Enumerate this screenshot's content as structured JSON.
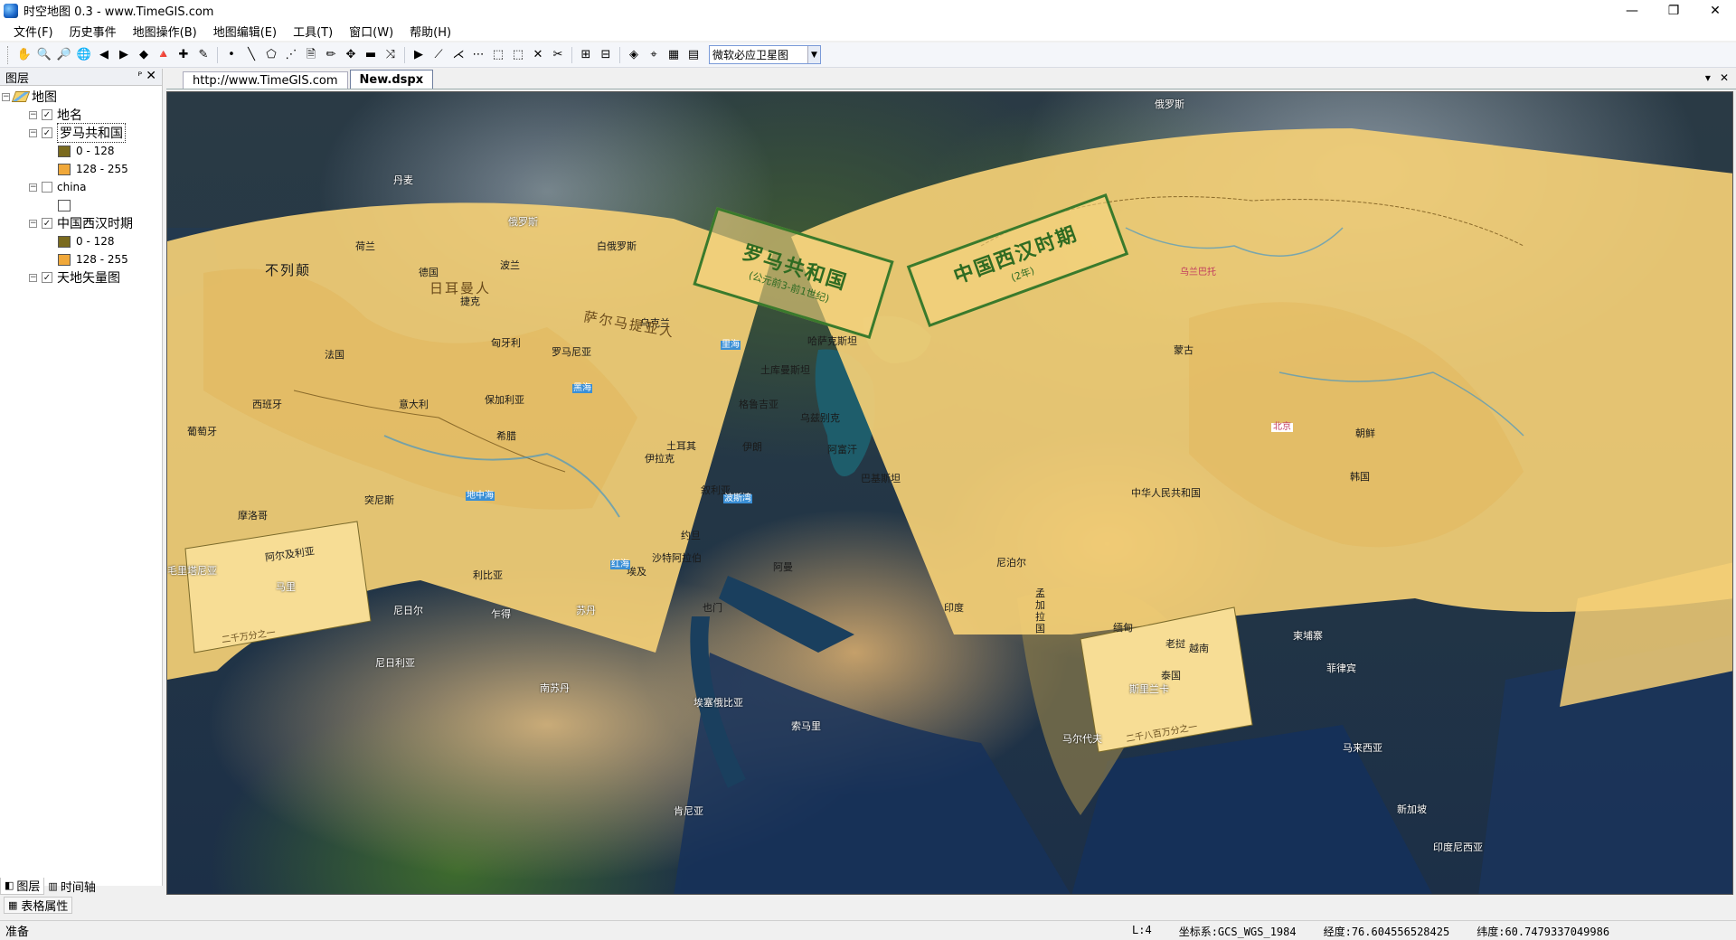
{
  "window": {
    "title": "时空地图 0.3 - www.TimeGIS.com",
    "minimize": "—",
    "restore": "❐",
    "close": "✕"
  },
  "menu": [
    "文件(F)",
    "历史事件",
    "地图操作(B)",
    "地图编辑(E)",
    "工具(T)",
    "窗口(W)",
    "帮助(H)"
  ],
  "toolbar": {
    "basemap_select": "微软必应卫星图",
    "icons": [
      "pan-icon",
      "zoom-in-icon",
      "zoom-out-icon",
      "globe-icon",
      "back-icon",
      "forward-icon",
      "layer-add-icon",
      "identify-icon",
      "add-feature-icon",
      "edit-feature-icon",
      "point-icon",
      "line-icon",
      "polygon-icon",
      "node-icon",
      "save-edit-icon",
      "measure-icon",
      "move-icon",
      "delete-feature-icon",
      "split-icon",
      "play-icon",
      "select-line-icon",
      "snap-icon",
      "vertex-icon",
      "select-icon",
      "select-clear-icon",
      "delete-icon",
      "cut-icon",
      "grid-icon",
      "table-icon",
      "compass-icon",
      "binoculars-icon",
      "chart-icon",
      "attribute-table-icon"
    ],
    "glyphs": [
      "✋",
      "🔍",
      "🔎",
      "🌐",
      "◀",
      "▶",
      "◆",
      "🔺",
      "✚",
      "✎",
      "•",
      "╲",
      "⬠",
      "⋰",
      "🗎",
      "✏",
      "✥",
      "▬",
      "⤨",
      "▶",
      "⟋",
      "⋌",
      "⋯",
      "⬚",
      "⬚",
      "✕",
      "✂",
      "⊞",
      "⊟",
      "◈",
      "⌖",
      "▦",
      "▤"
    ]
  },
  "layers_panel": {
    "title": "图层",
    "pin": "ᴾ",
    "close": "✕",
    "root": "地图",
    "items": [
      {
        "name": "地名",
        "checked": true,
        "expanded": true
      },
      {
        "name": "罗马共和国",
        "checked": true,
        "expanded": true,
        "selected": true,
        "legend": [
          {
            "label": "0 - 128",
            "color": "#7a6a1e"
          },
          {
            "label": "128 - 255",
            "color": "#f0a83a"
          }
        ]
      },
      {
        "name": "china",
        "checked": false,
        "expanded": true,
        "legend": [
          {
            "label": "",
            "color": "#ffffff"
          }
        ]
      },
      {
        "name": "中国西汉时期",
        "checked": true,
        "expanded": true,
        "legend": [
          {
            "label": "0 - 128",
            "color": "#7a6a1e"
          },
          {
            "label": "128 - 255",
            "color": "#f0a83a"
          }
        ]
      },
      {
        "name": "天地矢量图",
        "checked": true,
        "expanded": true
      }
    ],
    "tabs": [
      {
        "label": "图层",
        "active": true
      },
      {
        "label": "时间轴",
        "active": false
      }
    ],
    "table_props": "表格属性"
  },
  "doc_tabs": [
    {
      "label": "http://www.TimeGIS.com",
      "active": false
    },
    {
      "label": "New.dspx",
      "active": true
    }
  ],
  "doc_controls": {
    "dropdown": "▾",
    "close": "✕"
  },
  "map": {
    "banners": [
      {
        "title": "罗马共和国",
        "subtitle": "(公元前3-前1世纪)"
      },
      {
        "title": "中国西汉时期",
        "subtitle": "(2年)"
      }
    ],
    "scale_notes": [
      "二千万分之一",
      "二千八百万分之一"
    ],
    "labels_rome": [
      "不列颠",
      "荷兰",
      "德国",
      "丹麦",
      "波兰",
      "捷克",
      "匈牙利",
      "罗马尼亚",
      "乌克兰",
      "白俄罗斯",
      "俄罗斯",
      "法国",
      "西班牙",
      "葡萄牙",
      "意大利",
      "保加利亚",
      "希腊",
      "土耳其",
      "格鲁吉亚",
      "叙利亚",
      "约旦",
      "埃及",
      "利比亚",
      "阿尔及利亚",
      "突尼斯",
      "摩洛哥",
      "日耳曼人",
      "萨尔马提亚人",
      "黑海",
      "地中海"
    ],
    "labels_china": [
      "哈萨克斯坦",
      "蒙古",
      "北京",
      "朝鲜",
      "韩国",
      "中华人民共和国",
      "尼泊尔",
      "孟加拉国",
      "缅甸",
      "印度",
      "老挝",
      "越南",
      "泰国",
      "菲律宾",
      "乌兰巴托"
    ],
    "labels_world": [
      "俄罗斯",
      "里海",
      "乌兹别克",
      "土库曼斯坦",
      "伊拉克",
      "伊朗",
      "阿富汗",
      "巴基斯坦",
      "沙特阿拉伯",
      "也门",
      "阿曼",
      "红海",
      "波斯湾",
      "毛里塔尼亚",
      "马里",
      "尼日尔",
      "乍得",
      "苏丹",
      "尼日利亚",
      "南苏丹",
      "埃塞俄比亚",
      "索马里",
      "肯尼亚",
      "斯里兰卡",
      "马尔代夫",
      "马来西亚",
      "新加坡",
      "印度尼西亚",
      "柬埔寨"
    ]
  },
  "status": {
    "ready": "准备",
    "layer": "L:4",
    "crs": "坐标系:GCS_WGS_1984",
    "lon": "经度:76.604556528425",
    "lat": "纬度:60.7479337049986"
  }
}
